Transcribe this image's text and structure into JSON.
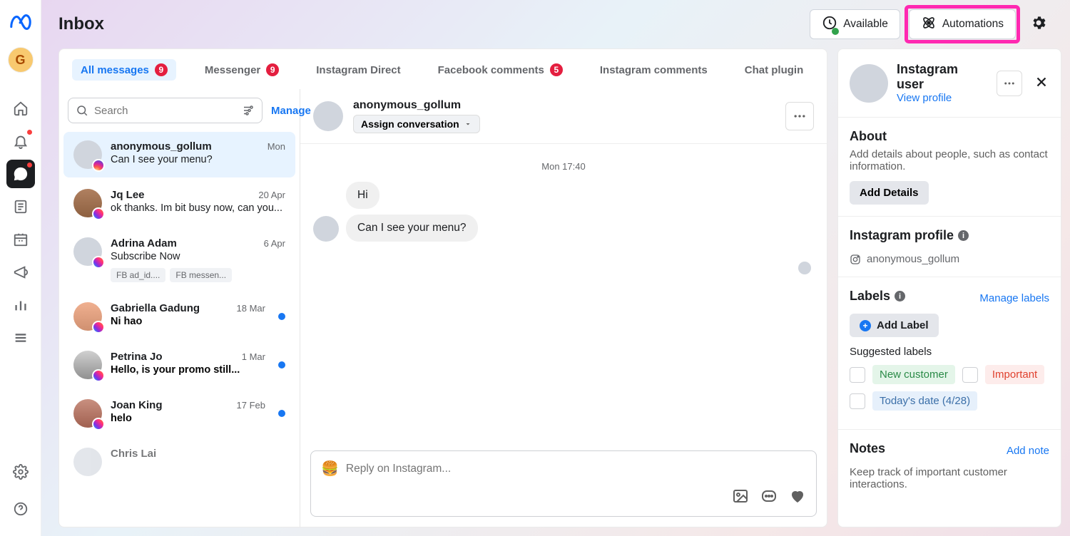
{
  "header": {
    "title": "Inbox",
    "available": "Available",
    "automations": "Automations"
  },
  "rail": {
    "avatar_letter": "G"
  },
  "tabs": [
    {
      "label": "All messages",
      "badge": "9",
      "active": true
    },
    {
      "label": "Messenger",
      "badge": "9"
    },
    {
      "label": "Instagram Direct"
    },
    {
      "label": "Facebook comments",
      "badge": "5"
    },
    {
      "label": "Instagram comments"
    },
    {
      "label": "Chat plugin"
    }
  ],
  "search": {
    "placeholder": "Search",
    "manage": "Manage"
  },
  "conversations": [
    {
      "name": "anonymous_gollum",
      "preview": "Can I see your menu?",
      "time": "Mon",
      "channel": "ig",
      "active": true
    },
    {
      "name": "Jq Lee",
      "preview": "ok thanks. Im bit busy now, can you...",
      "time": "20 Apr",
      "channel": "msgr"
    },
    {
      "name": "Adrina Adam",
      "preview": "Subscribe Now",
      "time": "6 Apr",
      "channel": "msgr",
      "tags": [
        "FB  ad_id....",
        "FB  messen..."
      ]
    },
    {
      "name": "Gabriella Gadung",
      "preview": "Ni hao",
      "time": "18 Mar",
      "channel": "msgr",
      "unread": true
    },
    {
      "name": "Petrina Jo",
      "preview": "Hello, is your promo still...",
      "time": "1 Mar",
      "channel": "msgr",
      "unread": true
    },
    {
      "name": "Joan King",
      "preview": "helo",
      "time": "17 Feb",
      "channel": "msgr",
      "unread": true
    },
    {
      "name": "Chris Lai",
      "preview": "",
      "time": "",
      "channel": "msgr"
    }
  ],
  "thread": {
    "name": "anonymous_gollum",
    "assign": "Assign conversation",
    "timestamp": "Mon 17:40",
    "messages": [
      "Hi",
      "Can I see your menu?"
    ],
    "reply_placeholder": "Reply on Instagram...",
    "emoji": "🍔"
  },
  "side": {
    "title": "Instagram user",
    "view_profile": "View profile",
    "about_heading": "About",
    "about_desc": "Add details about people, such as contact information.",
    "add_details": "Add Details",
    "ig_profile_heading": "Instagram profile",
    "ig_handle": "anonymous_gollum",
    "labels_heading": "Labels",
    "manage_labels": "Manage labels",
    "add_label": "Add Label",
    "suggested": "Suggested labels",
    "label_new_customer": "New customer",
    "label_important": "Important",
    "label_today": "Today's date (4/28)",
    "notes_heading": "Notes",
    "add_note": "Add note",
    "notes_desc": "Keep track of important customer interactions."
  }
}
